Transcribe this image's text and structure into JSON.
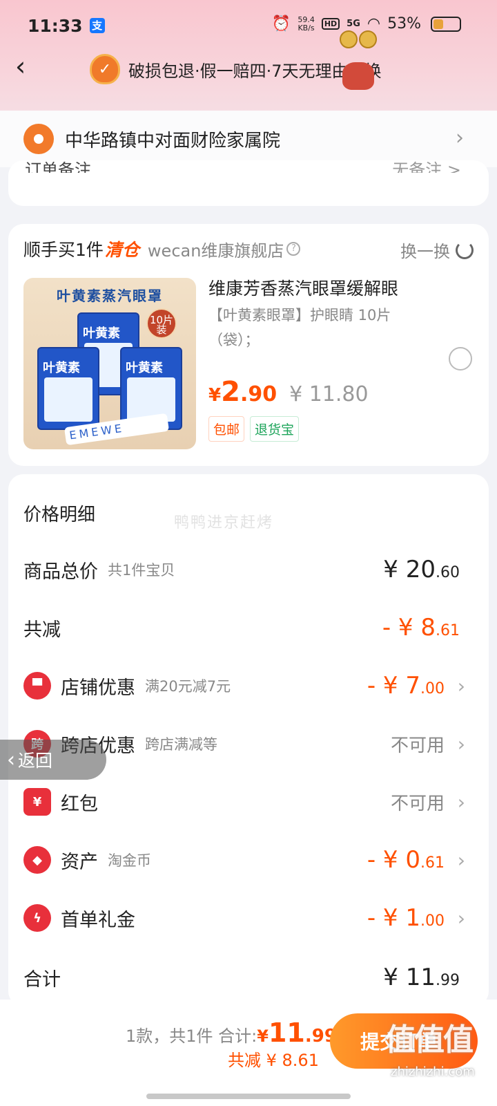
{
  "status_bar": {
    "time": "11:33",
    "pay_icon": "支",
    "net_speed_top": "59.4",
    "net_speed_bottom": "KB/s",
    "hd": "HD",
    "signal": "5G",
    "battery": "53%"
  },
  "header": {
    "guarantee_text": "破损包退·假一赔四·7天无理由退换"
  },
  "address": {
    "text": "中华路镇中对面财险家属院"
  },
  "order_note": {
    "label_fragment": "订单备注",
    "value_fragment": "无备注 >"
  },
  "recommend": {
    "title_prefix": "顺手买1件",
    "title_tag": "清仓",
    "shop": "wecan维康旗舰店",
    "swap_label": "换一换",
    "product": {
      "image_title": "叶黄素蒸汽眼罩",
      "box_label": "叶黄素",
      "badge": "10片装",
      "strip": "EMEWE",
      "name": "维康芳香蒸汽眼罩缓解眼",
      "desc": "【叶黄素眼罩】护眼睛 10片（袋）；",
      "price_yen": "¥",
      "price_int": "2",
      "price_dec": ".90",
      "price_old": "¥ 11.80",
      "tags": [
        "包邮",
        "退货宝"
      ]
    }
  },
  "price_detail": {
    "title": "价格明细",
    "watermark": "鸭鸭进京赶烤",
    "rows": [
      {
        "label": "商品总价",
        "sub": "共1件宝贝",
        "value_int": "¥ 20",
        "value_dec": ".60"
      },
      {
        "label": "共减",
        "sub": "",
        "value_int": "- ¥ 8",
        "value_dec": ".61"
      },
      {
        "label": "店铺优惠",
        "sub": "满20元减7元",
        "value_int": "- ¥ 7",
        "value_dec": ".00"
      },
      {
        "label": "跨店优惠",
        "sub": "跨店满减等",
        "value": "不可用"
      },
      {
        "label": "红包",
        "sub": "",
        "value": "不可用"
      },
      {
        "label": "资产",
        "sub": "淘金币",
        "value_int": "- ¥ 0",
        "value_dec": ".61"
      },
      {
        "label": "首单礼金",
        "sub": "",
        "value_int": "- ¥ 1",
        "value_dec": ".00"
      },
      {
        "label": "合计",
        "sub": "",
        "value_int": "¥ 11",
        "value_dec": ".99"
      }
    ],
    "icons": {
      "store": "store-icon",
      "cross": "跨",
      "redpacket": "¥",
      "asset": "tag-icon",
      "gift": "bolt-icon"
    }
  },
  "floating_back": {
    "label": "返回"
  },
  "bottom_bar": {
    "summary": "1款，共1件 合计:",
    "total_yen": "¥",
    "total_int": "11",
    "total_dec": ".99",
    "saved": "共减 ¥ 8.61",
    "submit_label": "提交订单"
  },
  "watermark_site": {
    "brand": "值值值",
    "url": "zhizhizhi.com"
  },
  "colors": {
    "accent": "#ff5000",
    "header_pink": "#f9c6cf",
    "green": "#1da45a"
  }
}
